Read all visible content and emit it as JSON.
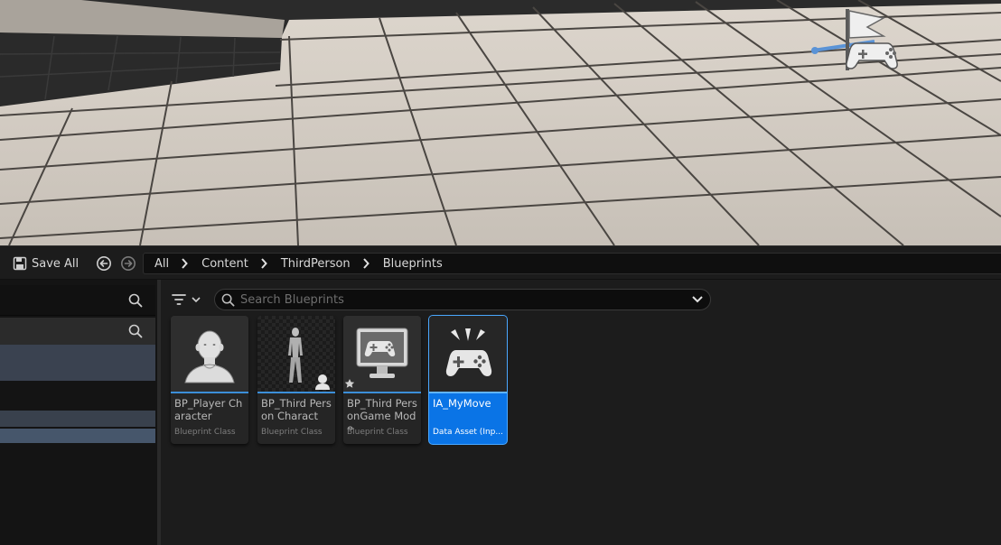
{
  "toolbar": {
    "save_all_label": "Save All"
  },
  "breadcrumb": {
    "items": [
      "All",
      "Content",
      "ThirdPerson",
      "Blueprints"
    ]
  },
  "search": {
    "placeholder": "Search Blueprints"
  },
  "assets": [
    {
      "name": "BP_Player Character",
      "type": "Blueprint Class",
      "thumbnail": "mannequin-head-icon"
    },
    {
      "name": "BP_Third Person Charact",
      "type": "Blueprint Class",
      "thumbnail": "character-figure-icon"
    },
    {
      "name": "BP_Third PersonGame Mode",
      "type": "Blueprint Class",
      "thumbnail": "monitor-gamepad-icon"
    },
    {
      "name": "IA_MyMove",
      "type": "Data Asset (Inp...",
      "thumbnail": "gamepad-input-icon",
      "selected": true
    }
  ],
  "colors": {
    "accent": "#0a74e6",
    "asset_bar": "#3c8fd9",
    "panel_bg": "#1c1c1c"
  }
}
